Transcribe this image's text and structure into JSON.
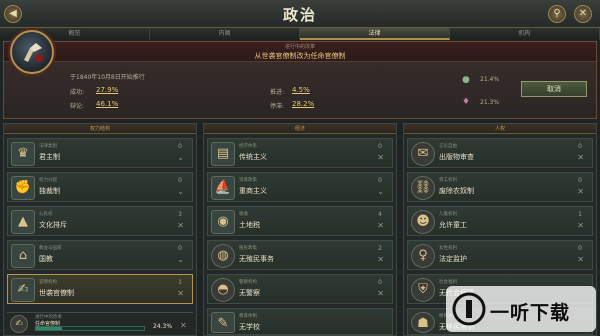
{
  "window": {
    "title": "政治"
  },
  "tabs": [
    {
      "label": "概览",
      "active": false
    },
    {
      "label": "内阁",
      "active": false
    },
    {
      "label": "法律",
      "active": true
    },
    {
      "label": "机构",
      "active": false
    }
  ],
  "law_change": {
    "subtitle": "进行中的改革",
    "title": "从世袭官僚制改为任命官僚制",
    "started_text": "于1840年10月8日开始推行",
    "success_label": "成功:",
    "success_value": "27.9%",
    "debate_label": "辩论:",
    "debate_value": "46.1%",
    "advance_label": "推进:",
    "advance_value": "4.5%",
    "stall_label": "停滞:",
    "stall_value": "28.2%",
    "support_value": "21.4%",
    "oppose_value": "21.3%",
    "cancel_label": "取消"
  },
  "columns": [
    {
      "title": "权力结构",
      "rows": [
        {
          "sub": "法律类别",
          "name": "君主制",
          "count": "0",
          "selected": false,
          "icon": "crown-icon",
          "glyph": "♛"
        },
        {
          "sub": "权力分配",
          "name": "独裁制",
          "count": "0",
          "selected": false,
          "icon": "fist-icon",
          "glyph": "✊"
        },
        {
          "sub": "公民权",
          "name": "文化排斥",
          "count": "3",
          "selected": false,
          "icon": "triangle-icon",
          "glyph": "▲"
        },
        {
          "sub": "教会与国家",
          "name": "国教",
          "count": "0",
          "selected": false,
          "icon": "temple-icon",
          "glyph": "⌂"
        },
        {
          "sub": "官僚机构",
          "name": "世袭官僚制",
          "count": "1",
          "selected": true,
          "icon": "hand-seal-icon",
          "glyph": "✍"
        }
      ],
      "progress": {
        "sub": "进行中的改革",
        "name": "任命官僚制",
        "value": "24.3%",
        "fraction": 0.243
      }
    },
    {
      "title": "经济",
      "rows": [
        {
          "sub": "经济体系",
          "name": "传统主义",
          "count": "0",
          "selected": false,
          "icon": "book-icon",
          "glyph": "▤"
        },
        {
          "sub": "贸易政策",
          "name": "重商主义",
          "count": "0",
          "selected": false,
          "icon": "ship-icon",
          "glyph": "⛵"
        },
        {
          "sub": "税收",
          "name": "土地税",
          "count": "4",
          "selected": false,
          "icon": "coin-stack-icon",
          "glyph": "◉"
        },
        {
          "sub": "殖民政策",
          "name": "无殖民事务",
          "count": "2",
          "selected": false,
          "icon": "globe-icon",
          "glyph": "◍"
        },
        {
          "sub": "警察机构",
          "name": "无警察",
          "count": "0",
          "selected": false,
          "icon": "helmet-icon",
          "glyph": "◓"
        },
        {
          "sub": "教育体制",
          "name": "无学校",
          "count": "",
          "selected": false,
          "icon": "school-icon",
          "glyph": "✎"
        }
      ]
    },
    {
      "title": "人权",
      "rows": [
        {
          "sub": "言论自由",
          "name": "出版物审查",
          "count": "0",
          "selected": false,
          "icon": "press-icon",
          "glyph": "✉"
        },
        {
          "sub": "劳工权利",
          "name": "废除农奴制",
          "count": "0",
          "selected": false,
          "icon": "chain-icon",
          "glyph": "⛓"
        },
        {
          "sub": "儿童权利",
          "name": "允许童工",
          "count": "1",
          "selected": false,
          "icon": "child-icon",
          "glyph": "☻"
        },
        {
          "sub": "女性权利",
          "name": "法定监护",
          "count": "0",
          "selected": false,
          "icon": "woman-icon",
          "glyph": "♀"
        },
        {
          "sub": "社会福利",
          "name": "无社会保障",
          "count": "",
          "selected": false,
          "icon": "shield-icon",
          "glyph": "⛨"
        },
        {
          "sub": "移民政策",
          "name": "无移民限制",
          "count": "",
          "selected": false,
          "icon": "person-icon",
          "glyph": "☗"
        }
      ]
    }
  ],
  "watermark": {
    "text": "一听下载"
  }
}
